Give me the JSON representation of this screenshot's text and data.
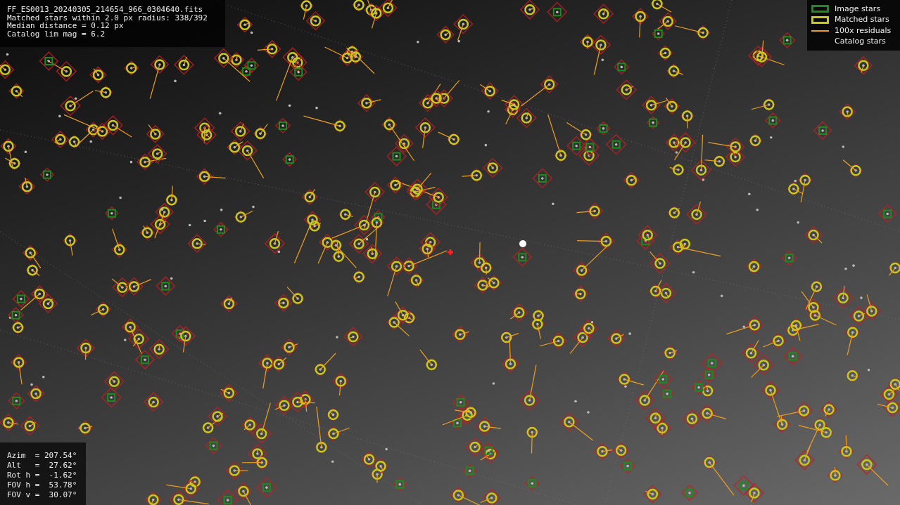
{
  "info_panel": {
    "lines": [
      "FF_ES0013_20240305_214654_966_0304640.fits",
      "Matched stars within 2.0 px radius: 338/392",
      "Median distance = 0.12 px",
      "Catalog lim mag = 6.2"
    ]
  },
  "legend": [
    {
      "kind": "box",
      "label": "Image stars",
      "color": "#1f8a1f"
    },
    {
      "kind": "box",
      "label": "Matched stars",
      "color": "#c8c81e"
    },
    {
      "kind": "line",
      "label": "100x residuals",
      "color": "#f0a020"
    },
    {
      "kind": "none",
      "label": "Catalog stars"
    }
  ],
  "pointing_panel": {
    "lines": [
      "Azim  = 207.54°",
      "Alt   =  27.62°",
      "Rot h =  -1.62°",
      "FOV h =  53.78°",
      "FOV v =  30.07°"
    ]
  }
}
